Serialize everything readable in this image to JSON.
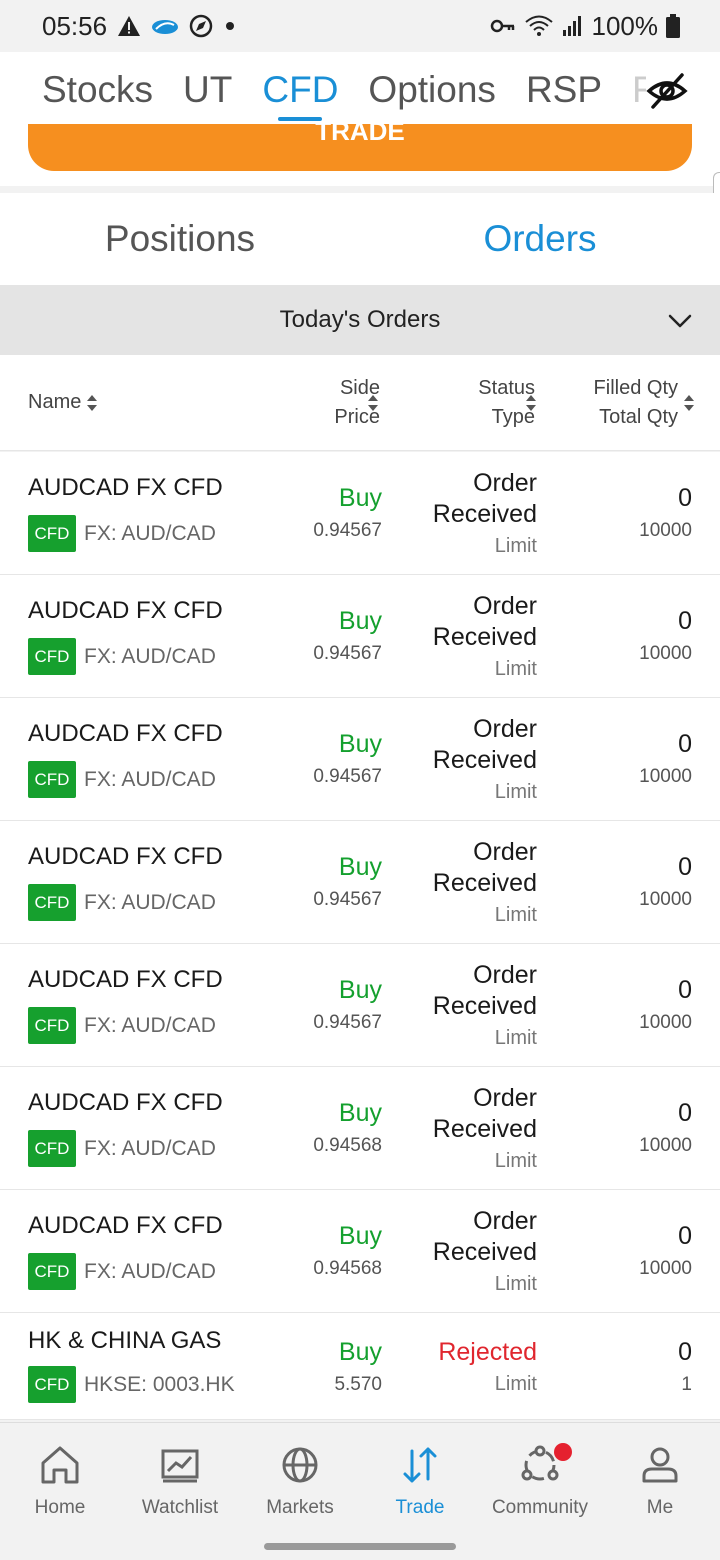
{
  "status_bar": {
    "time": "05:56",
    "battery": "100%"
  },
  "top_tabs": [
    "Stocks",
    "UT",
    "CFD",
    "Options",
    "RSP",
    "F"
  ],
  "active_top_tab": "CFD",
  "trade_button": "TRADE",
  "sub_tabs": {
    "positions": "Positions",
    "orders": "Orders"
  },
  "filter": {
    "label": "Today's Orders"
  },
  "columns": {
    "name": "Name",
    "side": "Side",
    "price": "Price",
    "status": "Status",
    "type": "Type",
    "filled_qty": "Filled Qty",
    "total_qty": "Total Qty"
  },
  "orders": [
    {
      "name": "AUDCAD FX CFD",
      "badge": "CFD",
      "market": "FX: AUD/CAD",
      "side": "Buy",
      "price": "0.94567",
      "status": "Order Received",
      "type": "Limit",
      "filled": "0",
      "total": "10000"
    },
    {
      "name": "AUDCAD FX CFD",
      "badge": "CFD",
      "market": "FX: AUD/CAD",
      "side": "Buy",
      "price": "0.94567",
      "status": "Order Received",
      "type": "Limit",
      "filled": "0",
      "total": "10000"
    },
    {
      "name": "AUDCAD FX CFD",
      "badge": "CFD",
      "market": "FX: AUD/CAD",
      "side": "Buy",
      "price": "0.94567",
      "status": "Order Received",
      "type": "Limit",
      "filled": "0",
      "total": "10000"
    },
    {
      "name": "AUDCAD FX CFD",
      "badge": "CFD",
      "market": "FX: AUD/CAD",
      "side": "Buy",
      "price": "0.94567",
      "status": "Order Received",
      "type": "Limit",
      "filled": "0",
      "total": "10000"
    },
    {
      "name": "AUDCAD FX CFD",
      "badge": "CFD",
      "market": "FX: AUD/CAD",
      "side": "Buy",
      "price": "0.94567",
      "status": "Order Received",
      "type": "Limit",
      "filled": "0",
      "total": "10000"
    },
    {
      "name": "AUDCAD FX CFD",
      "badge": "CFD",
      "market": "FX: AUD/CAD",
      "side": "Buy",
      "price": "0.94568",
      "status": "Order Received",
      "type": "Limit",
      "filled": "0",
      "total": "10000"
    },
    {
      "name": "AUDCAD FX CFD",
      "badge": "CFD",
      "market": "FX: AUD/CAD",
      "side": "Buy",
      "price": "0.94568",
      "status": "Order Received",
      "type": "Limit",
      "filled": "0",
      "total": "10000"
    },
    {
      "name": "HK & CHINA GAS",
      "badge": "CFD",
      "market": "HKSE: 0003.HK",
      "side": "Buy",
      "price": "5.570",
      "status": "Rejected",
      "type": "Limit",
      "filled": "0",
      "total": "1"
    }
  ],
  "bottom_nav": [
    {
      "label": "Home",
      "icon": "home-icon"
    },
    {
      "label": "Watchlist",
      "icon": "watchlist-icon"
    },
    {
      "label": "Markets",
      "icon": "globe-icon"
    },
    {
      "label": "Trade",
      "icon": "trade-arrows-icon"
    },
    {
      "label": "Community",
      "icon": "community-icon"
    },
    {
      "label": "Me",
      "icon": "person-icon"
    }
  ],
  "colors": {
    "accent": "#1a8fd6",
    "trade_button": "#f68f1f",
    "buy": "#14a02e",
    "rejected": "#e0262e",
    "badge": "#16a02e",
    "notification_dot": "#e5212f"
  }
}
